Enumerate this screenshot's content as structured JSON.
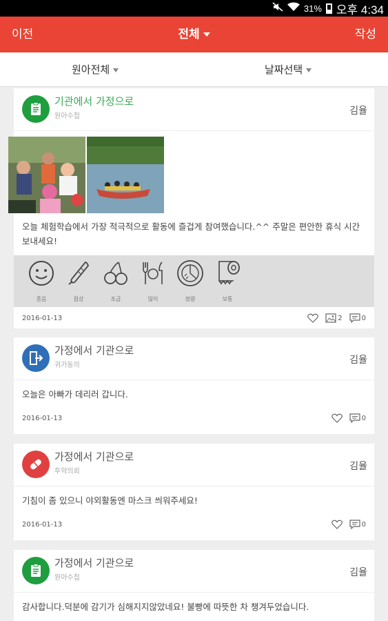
{
  "status_bar": {
    "battery": "31%",
    "time": "오후 4:34"
  },
  "header": {
    "back_label": "이전",
    "title": "전체",
    "write_label": "작성"
  },
  "filters": {
    "child": "원아전체",
    "date": "날짜선택"
  },
  "posts": [
    {
      "icon": "clipboard-icon",
      "title": "기관에서 가정으로",
      "subtitle": "원아수첩",
      "author": "김율",
      "message": "오늘 체험학습에서 가장 적극적으로 활동에 즐겁게 참여했습니다.^^ 주말은 편안한 휴식 시간 보내세요!",
      "status_labels": [
        "종음",
        "점상",
        "조금",
        "많이",
        "정량",
        "보통"
      ],
      "date": "2016-01-13",
      "photo_count": "2",
      "comment_count": "0"
    },
    {
      "icon": "exit-door-icon",
      "title": "가정에서 기관으로",
      "subtitle": "귀가동의",
      "author": "김율",
      "message": "오늘은 아빠가 데리러 갑니다.",
      "date": "2016-01-13",
      "comment_count": "0"
    },
    {
      "icon": "pill-icon",
      "title": "가정에서 기관으로",
      "subtitle": "투약의뢰",
      "author": "김율",
      "message": "기침이 좀 있으니 야외활동엔 마스크 씌워주세요!",
      "date": "2016-01-13",
      "comment_count": "0"
    },
    {
      "icon": "clipboard-icon",
      "title": "가정에서 기관으로",
      "subtitle": "원아수첩",
      "author": "김율",
      "message": "감사합니다.덕분에 감기가 심해지지않았네요! 불빵에 따뜻한 차 챙겨두었습니다."
    }
  ],
  "colors": {
    "accent": "#e94435",
    "green": "#1e9e3e",
    "blue": "#2f6fb8",
    "red": "#e14040"
  }
}
